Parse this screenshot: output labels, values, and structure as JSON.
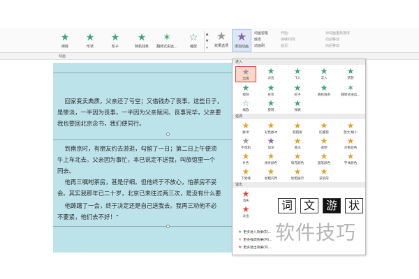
{
  "ribbon": {
    "gallery_items": [
      {
        "label": "擦除",
        "icon": "wipe-star-icon",
        "color": "#3aa874"
      },
      {
        "label": "形状",
        "icon": "shape-star-icon",
        "color": "#3aa874"
      },
      {
        "label": "轮子",
        "icon": "wheel-star-icon",
        "color": "#3aa874"
      },
      {
        "label": "随机线条",
        "icon": "random-bars-star-icon",
        "color": "#3aa874"
      },
      {
        "label": "翻转式由远...",
        "icon": "grow-turn-star-icon",
        "color": "#3aa874"
      },
      {
        "label": "缩放",
        "icon": "zoom-star-icon",
        "color": "#3aa874"
      }
    ],
    "effect_options_label": "效果选项",
    "add_animation_label": "添加动画",
    "pane_opts": [
      "动画窗格",
      "触发",
      "动画刷"
    ],
    "timing_labels": [
      "开始:",
      "持续时间:",
      "延迟:"
    ],
    "reorder_labels": [
      "对动画重新排序",
      "向前移动",
      "向后移动"
    ],
    "group_label": "动画"
  },
  "document": {
    "paragraphs": [
      "    回家变卖典质，父亲还了亏空；又借钱办了丧事。这些日子，",
      "是惨淡，一半因为丧事，一半因为父亲赋闲。丧事完毕，父亲要",
      "我也要回北京念书，我们便同行。",
      "    到南京时，有朋友约去游逛，勾留了一日；第二日上午便须",
      "午上车北去。父亲因为事忙，本已说定不送我，叫旅馆里一个",
      "同去。",
      "    他再三嘱咐茶房，甚是仔细。但他终于不放心，怕茶房不妥",
      "会。其实我那年已二十岁，北京已来往过两三次，是没有什么要",
      "    他踌躇了一会，终于决定还是自己送我去。我再三劝他不必",
      "不要紧，他们去不好！”"
    ]
  },
  "gallery": {
    "sections": {
      "entrance": "进入",
      "emphasis": "强调",
      "exit": "退出"
    },
    "entrance_items": [
      {
        "label": "出现",
        "selected": true
      },
      {
        "label": "淡出"
      },
      {
        "label": "飞入"
      },
      {
        "label": "浮入"
      },
      {
        "label": "劈裂"
      },
      {
        "label": "擦除"
      },
      {
        "label": "形状"
      },
      {
        "label": "轮子"
      },
      {
        "label": "随机线条"
      },
      {
        "label": "翻转式由远..."
      },
      {
        "label": "缩放"
      },
      {
        "label": "旋转"
      },
      {
        "label": "弹跳"
      }
    ],
    "emphasis_items": [
      {
        "label": "脉冲"
      },
      {
        "label": "彩色脉冲"
      },
      {
        "label": "跷跷板"
      },
      {
        "label": "陀螺旋"
      },
      {
        "label": "放大/缩小"
      },
      {
        "label": "不饱和"
      },
      {
        "label": "加深"
      },
      {
        "label": "变淡"
      },
      {
        "label": "透明"
      },
      {
        "label": "对象颜色"
      },
      {
        "label": "补色"
      },
      {
        "label": "线条颜色"
      },
      {
        "label": "填充颜色"
      },
      {
        "label": "画笔颜色"
      },
      {
        "label": "字体颜色"
      },
      {
        "label": "下划线"
      },
      {
        "label": "加粗闪烁"
      },
      {
        "label": "加粗展示"
      },
      {
        "label": "波浪形"
      }
    ],
    "exit_items": [
      {
        "label": "消失"
      },
      {
        "label": "淡出"
      }
    ],
    "more_links": [
      "更多进入效果(E)...",
      "更多强调效果(M)...",
      "更多退出效果(X)..."
    ]
  },
  "thumbs": [
    "词",
    "文",
    "游",
    "状"
  ],
  "watermark": "软件技巧",
  "colors": {
    "entrance": "#3aa874",
    "emphasis": "#e0a52a",
    "exit": "#d94a3a",
    "doc_bg": "#bde3ea",
    "selected_border": "#d9363e"
  }
}
